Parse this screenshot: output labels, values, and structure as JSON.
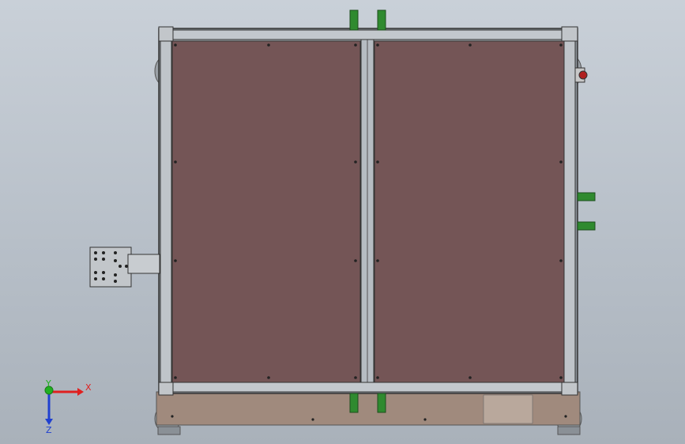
{
  "viewport": {
    "background_top": "#c9d0d8",
    "background_bottom": "#a9b1ba"
  },
  "model": {
    "panel_color": "#745556",
    "frame_color": "#8d949b",
    "base_plate_color": "#a08a7d",
    "connector_color": "#2f8a2f",
    "bracket_color": "#c2c6ca"
  },
  "triad": {
    "x_label": "X",
    "y_label": "Y",
    "z_label": "Z",
    "x_color": "#e02020",
    "y_color": "#20b020",
    "z_color": "#2040d0"
  }
}
